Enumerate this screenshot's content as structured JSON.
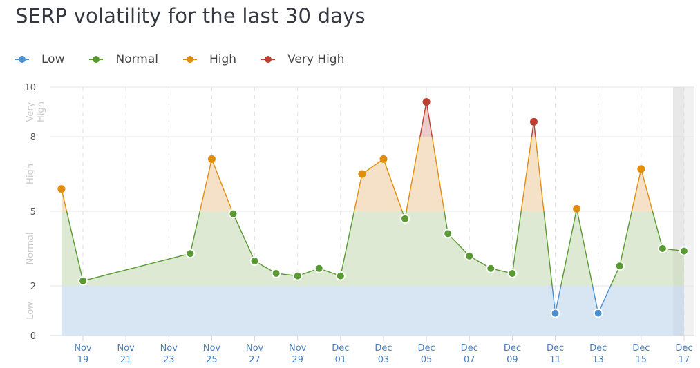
{
  "title": "SERP volatility for the last 30 days",
  "legend": [
    {
      "label": "Low",
      "color": "#4a8fd0"
    },
    {
      "label": "Normal",
      "color": "#5a9a34"
    },
    {
      "label": "High",
      "color": "#e08e0b"
    },
    {
      "label": "Very High",
      "color": "#b94033"
    }
  ],
  "chart_data": {
    "type": "area",
    "title": "SERP volatility for the last 30 days",
    "xlabel": "",
    "ylabel": "",
    "ylim": [
      0,
      10
    ],
    "yticks": [
      0,
      2,
      5,
      8,
      10
    ],
    "grid": true,
    "legend_position": "top-left",
    "zones": [
      {
        "name": "Low",
        "from": 0,
        "to": 2,
        "color": "#4a8fd0",
        "fill": "#d8e6f4"
      },
      {
        "name": "Normal",
        "from": 2,
        "to": 5,
        "color": "#5a9a34",
        "fill": "#dde9d3"
      },
      {
        "name": "High",
        "from": 5,
        "to": 8,
        "color": "#e08e0b",
        "fill": "#f5e1c8"
      },
      {
        "name": "Very High",
        "from": 8,
        "to": 10,
        "color": "#b94033",
        "fill": "#eccccb"
      }
    ],
    "zone_labels": [
      {
        "label": "Low",
        "center": 1
      },
      {
        "label": "Normal",
        "center": 3.5
      },
      {
        "label": "High",
        "center": 6.5
      },
      {
        "label": "Very High",
        "center": 9
      }
    ],
    "x_start_day": -1,
    "x_end_day": 29,
    "xticks": [
      {
        "day": 0,
        "month": "Nov",
        "date": "19"
      },
      {
        "day": 2,
        "month": "Nov",
        "date": "21"
      },
      {
        "day": 4,
        "month": "Nov",
        "date": "23"
      },
      {
        "day": 6,
        "month": "Nov",
        "date": "25"
      },
      {
        "day": 8,
        "month": "Nov",
        "date": "27"
      },
      {
        "day": 10,
        "month": "Nov",
        "date": "29"
      },
      {
        "day": 12,
        "month": "Dec",
        "date": "01"
      },
      {
        "day": 14,
        "month": "Dec",
        "date": "03"
      },
      {
        "day": 16,
        "month": "Dec",
        "date": "05"
      },
      {
        "day": 18,
        "month": "Dec",
        "date": "07"
      },
      {
        "day": 20,
        "month": "Dec",
        "date": "09"
      },
      {
        "day": 22,
        "month": "Dec",
        "date": "11"
      },
      {
        "day": 24,
        "month": "Dec",
        "date": "13"
      },
      {
        "day": 26,
        "month": "Dec",
        "date": "15"
      },
      {
        "day": 28,
        "month": "Dec",
        "date": "17"
      }
    ],
    "highlight_day": 28,
    "series": [
      {
        "name": "SERP volatility",
        "points": [
          {
            "date": "Nov 18",
            "day": -1,
            "value": 5.9
          },
          {
            "date": "Nov 19",
            "day": 0,
            "value": 2.2
          },
          {
            "date": "Nov 24",
            "day": 5,
            "value": 3.3
          },
          {
            "date": "Nov 25",
            "day": 6,
            "value": 7.1
          },
          {
            "date": "Nov 26",
            "day": 7,
            "value": 4.9
          },
          {
            "date": "Nov 27",
            "day": 8,
            "value": 3.0
          },
          {
            "date": "Nov 28",
            "day": 9,
            "value": 2.5
          },
          {
            "date": "Nov 29",
            "day": 10,
            "value": 2.4
          },
          {
            "date": "Nov 30",
            "day": 11,
            "value": 2.7
          },
          {
            "date": "Dec 01",
            "day": 12,
            "value": 2.4
          },
          {
            "date": "Dec 02",
            "day": 13,
            "value": 6.5
          },
          {
            "date": "Dec 03",
            "day": 14,
            "value": 7.1
          },
          {
            "date": "Dec 04",
            "day": 15,
            "value": 4.7
          },
          {
            "date": "Dec 05",
            "day": 16,
            "value": 9.4
          },
          {
            "date": "Dec 06",
            "day": 17,
            "value": 4.1
          },
          {
            "date": "Dec 07",
            "day": 18,
            "value": 3.2
          },
          {
            "date": "Dec 08",
            "day": 19,
            "value": 2.7
          },
          {
            "date": "Dec 09",
            "day": 20,
            "value": 2.5
          },
          {
            "date": "Dec 10",
            "day": 21,
            "value": 8.6
          },
          {
            "date": "Dec 11",
            "day": 22,
            "value": 0.9
          },
          {
            "date": "Dec 12",
            "day": 23,
            "value": 5.1
          },
          {
            "date": "Dec 13",
            "day": 24,
            "value": 0.9
          },
          {
            "date": "Dec 14",
            "day": 25,
            "value": 2.8
          },
          {
            "date": "Dec 15",
            "day": 26,
            "value": 6.7
          },
          {
            "date": "Dec 16",
            "day": 27,
            "value": 3.5
          },
          {
            "date": "Dec 17",
            "day": 28,
            "value": 3.4
          }
        ]
      }
    ]
  }
}
